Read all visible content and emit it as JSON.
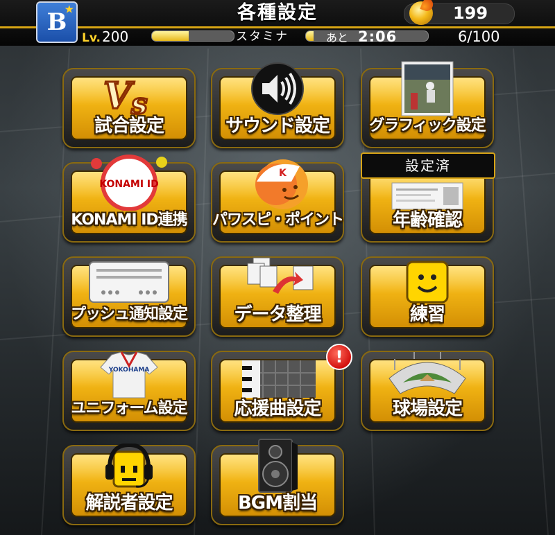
{
  "header": {
    "title": "各種設定",
    "team_logo_text": "B",
    "team_icon": "team-logo-icon",
    "coins": "199",
    "coin_icon": "coin-flame-icon",
    "level_prefix": "Lv.",
    "level": "200",
    "level_progress": 0.45,
    "stamina_label": "スタミナ",
    "stamina_recover_prefix": "あと",
    "stamina_recover_time": "2:06",
    "stamina_count": "6/100",
    "stamina_fraction": 0.06,
    "accent_color": "#d7a514"
  },
  "menu": {
    "items": [
      {
        "label": "試合設定",
        "icon": "vs-icon"
      },
      {
        "label": "サウンド設定",
        "icon": "speaker-icon"
      },
      {
        "label": "グラフィック設定",
        "icon": "screenshot-icon"
      },
      {
        "label": "KONAMI ID連携",
        "icon": "konami-id-icon",
        "icon_text": "KONAMI ID"
      },
      {
        "label": "パワスピ・ポイント",
        "icon": "mascot-face-icon",
        "icon_text": "K"
      },
      {
        "label": "年齢確認",
        "icon": "id-card-icon",
        "badge": "設定済"
      },
      {
        "label": "プッシュ通知設定",
        "icon": "notification-device-icon"
      },
      {
        "label": "データ整理",
        "icon": "documents-transfer-icon"
      },
      {
        "label": "練習",
        "icon": "smiley-block-icon"
      },
      {
        "label": "ユニフォーム設定",
        "icon": "uniform-icon",
        "icon_text": "YOKOHAMA"
      },
      {
        "label": "応援曲設定",
        "icon": "piano-keys-icon",
        "alert": "!"
      },
      {
        "label": "球場設定",
        "icon": "stadium-icon"
      },
      {
        "label": "解説者設定",
        "icon": "headset-icon"
      },
      {
        "label": "BGM割当",
        "icon": "loudspeaker-icon"
      }
    ]
  },
  "colors": {
    "tile_gold": "#f2b514",
    "tile_frame": "#1c1c1c",
    "alert_red": "#d3120f"
  }
}
